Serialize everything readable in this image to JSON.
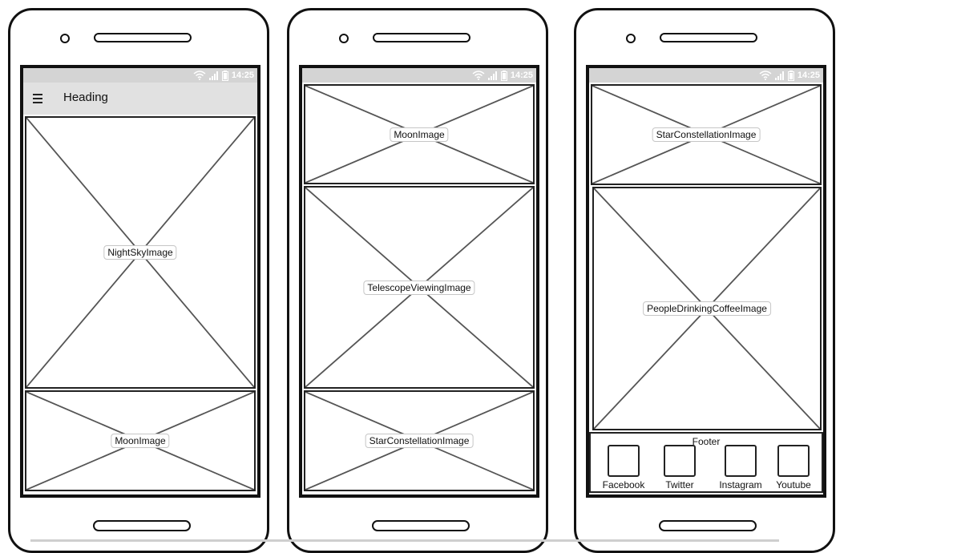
{
  "status_bar": {
    "time": "14:25"
  },
  "phone1": {
    "heading": "Heading",
    "images": [
      "NightSkyImage",
      "MoonImage"
    ]
  },
  "phone2": {
    "images": [
      "MoonImage",
      "TelescopeViewingImage",
      "StarConstellationImage"
    ]
  },
  "phone3": {
    "images": [
      "StarConstellationImage",
      "PeopleDrinkingCoffeeImage"
    ],
    "footer": {
      "title": "Footer",
      "links": [
        "Facebook",
        "Twitter",
        "Instagram",
        "Youtube"
      ]
    }
  },
  "icons": {
    "menu": "hamburger-menu-icon",
    "wifi": "wifi-icon",
    "signal": "signal-icon",
    "battery": "battery-icon"
  },
  "colors": {
    "statusbar": "#d4d4d4",
    "appbar": "#e1e1e1",
    "ink": "#222222"
  }
}
